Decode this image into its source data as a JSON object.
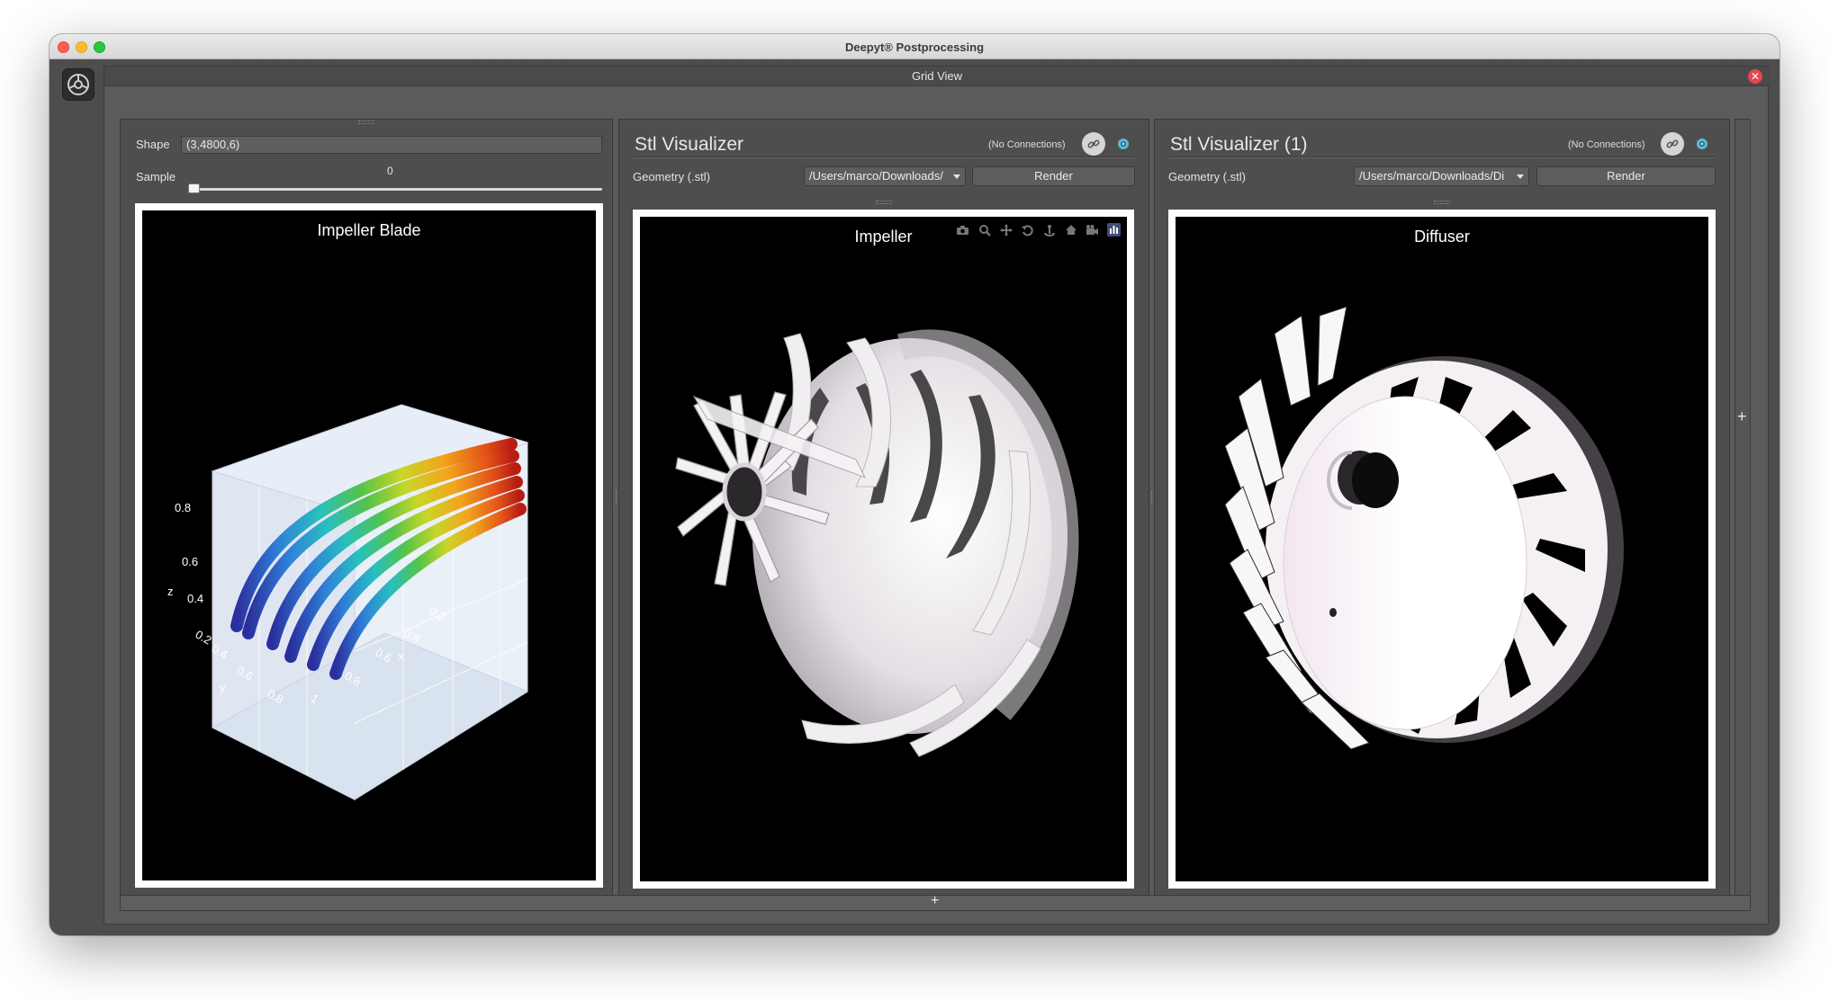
{
  "window": {
    "title": "Deepyt® Postprocessing"
  },
  "grid_view": {
    "title": "Grid View",
    "close_glyph": "✕",
    "add_row_glyph": "+",
    "add_col_glyph": "+"
  },
  "panel1": {
    "shape_label": "Shape",
    "shape_value": "(3,4800,6)",
    "sample_label": "Sample",
    "sample_value": "0",
    "slider_fraction": 0,
    "plot": {
      "title": "Impeller Blade",
      "axes": {
        "x_label": "x",
        "y_label": "y",
        "z_label": "z",
        "x_ticks": [
          "0.2",
          "0.4",
          "0.6",
          "0.8",
          "1"
        ],
        "y_ticks": [
          "0.2",
          "0.4",
          "0.6",
          "0.8"
        ],
        "z_ticks": [
          "0.8",
          "0.6",
          "0.4"
        ]
      }
    }
  },
  "panel2": {
    "title": "Stl Visualizer",
    "connections": "(No Connections)",
    "geometry_label": "Geometry (.stl)",
    "geometry_path": "/Users/marco/Downloads/",
    "render_label": "Render",
    "plot_title": "Impeller",
    "toolbar_icons": [
      "camera-icon",
      "zoom-icon",
      "pan-icon",
      "orbit-icon",
      "turntable-icon",
      "home-icon",
      "camera-view-icon",
      "plotly-logo-icon"
    ]
  },
  "panel3": {
    "title": "Stl Visualizer (1)",
    "connections": "(No Connections)",
    "geometry_label": "Geometry (.stl)",
    "geometry_path": "/Users/marco/Downloads/Di",
    "render_label": "Render",
    "plot_title": "Diffuser"
  },
  "colors": {
    "accent_close": "#e64553",
    "mesh": "#efeaee",
    "scene_bg": "#e5ecf6"
  }
}
